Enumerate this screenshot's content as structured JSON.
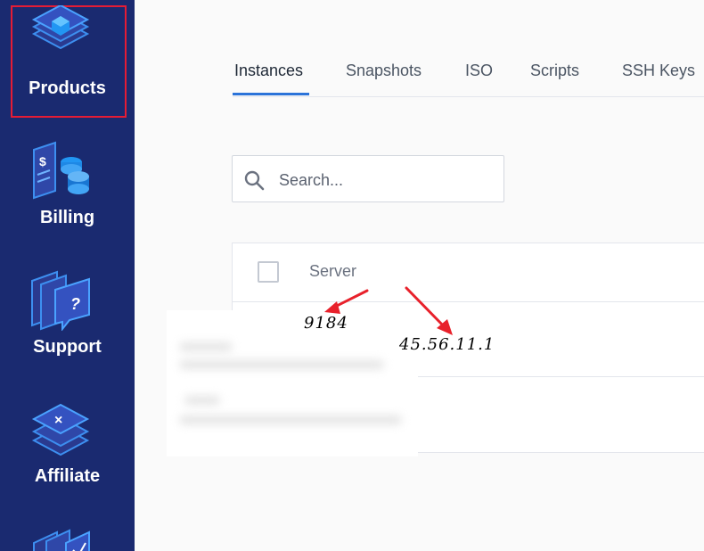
{
  "sidebar": {
    "items": [
      {
        "label": "Products",
        "icon": "products-layers-icon"
      },
      {
        "label": "Billing",
        "icon": "billing-icon"
      },
      {
        "label": "Support",
        "icon": "support-icon"
      },
      {
        "label": "Affiliate",
        "icon": "affiliate-icon"
      },
      {
        "label": "",
        "icon": "extra-nav-icon"
      }
    ],
    "background": "#1a2a70",
    "highlight_color": "#e51c35"
  },
  "tabs": [
    "Instances",
    "Snapshots",
    "ISO",
    "Scripts",
    "SSH Keys"
  ],
  "search": {
    "placeholder": "Search..."
  },
  "table": {
    "header": "Server"
  },
  "annotations": {
    "port": "9184",
    "ip": "45.56.11.1",
    "arrow_color": "#e8212b"
  },
  "accent": "#2b73d9"
}
